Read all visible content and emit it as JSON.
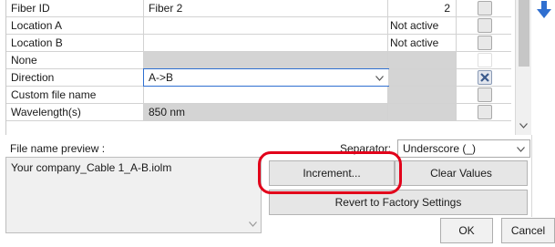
{
  "grid": {
    "rows": [
      {
        "label": "Fiber ID",
        "value": "Fiber 2",
        "status": "",
        "number": "2",
        "checkbox": "normal",
        "gray_value": false,
        "gray_status": false
      },
      {
        "label": "Location A",
        "value": "",
        "status": "Not active",
        "number": "",
        "checkbox": "normal",
        "gray_value": false,
        "gray_status": false
      },
      {
        "label": "Location B",
        "value": "",
        "status": "Not active",
        "number": "",
        "checkbox": "normal",
        "gray_value": false,
        "gray_status": false
      },
      {
        "label": "None",
        "value": "",
        "status": "",
        "number": "",
        "checkbox": "white",
        "gray_value": true,
        "gray_status": true
      },
      {
        "label": "Direction",
        "value": "A->B",
        "status": "",
        "number": "",
        "checkbox": "checked",
        "gray_value": false,
        "gray_status": true,
        "dropdown": true
      },
      {
        "label": "Custom file name",
        "value": "",
        "status": "",
        "number": "",
        "checkbox": "normal",
        "gray_value": false,
        "gray_status": true
      },
      {
        "label": "Wavelength(s)",
        "value": "850 nm",
        "status": "",
        "number": "",
        "checkbox": "normal",
        "gray_value": true,
        "gray_status": true
      }
    ]
  },
  "preview": {
    "label": "File name preview :",
    "value": "Your company_Cable 1_A-B.iolm"
  },
  "separator": {
    "label": "Separator:",
    "selected": "Underscore (_)"
  },
  "buttons": {
    "increment": "Increment...",
    "clear_values": "Clear Values",
    "revert": "Revert to Factory Settings",
    "ok": "OK",
    "cancel": "Cancel"
  },
  "icons": {
    "move_down": "arrow-down-icon",
    "dropdown": "chevron-down-icon",
    "check": "check-x-icon"
  },
  "colors": {
    "accent_blue": "#2f6fd0",
    "highlight_red": "#e2001a",
    "gray_cell": "#d4d4d4"
  }
}
